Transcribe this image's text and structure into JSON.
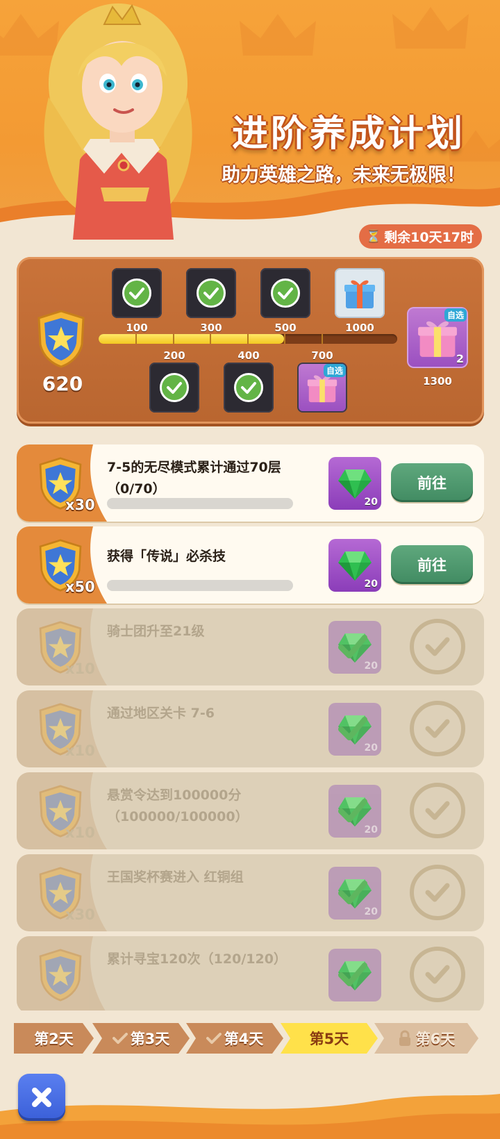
{
  "header": {
    "title": "进阶养成计划",
    "subtitle": "助力英雄之路，未来无极限！",
    "timer": "剩余10天17时"
  },
  "progress": {
    "current_points": "620",
    "current_value": 620,
    "max_value": 1000,
    "milestones_top": [
      {
        "label": "100",
        "reward": "check",
        "claimed": true
      },
      {
        "label": "300",
        "reward": "check",
        "claimed": true
      },
      {
        "label": "500",
        "reward": "check",
        "claimed": true
      },
      {
        "label": "1000",
        "reward": "gift-blue",
        "claimed": false
      }
    ],
    "milestones_bottom": [
      {
        "label": "200",
        "reward": "check",
        "claimed": true
      },
      {
        "label": "400",
        "reward": "check",
        "claimed": true
      },
      {
        "label": "700",
        "reward": "gift-pink",
        "tag": "自选",
        "claimed": false
      }
    ],
    "final_reward": {
      "label": "1300",
      "tag": "自选",
      "count": "2"
    }
  },
  "tasks": [
    {
      "desc": "7-5的无尽模式累计通过70层（0/70）",
      "multiplier": "x30",
      "gem_count": "20",
      "button": "前往",
      "progress": 0,
      "done": false
    },
    {
      "desc": "获得「传说」必杀技",
      "multiplier": "x50",
      "gem_count": "20",
      "button": "前往",
      "progress": 0,
      "done": false
    },
    {
      "desc": "骑士团升至21级",
      "multiplier": "x10",
      "gem_count": "20",
      "done": true
    },
    {
      "desc": "通过地区关卡 7-6",
      "multiplier": "x10",
      "gem_count": "20",
      "done": true
    },
    {
      "desc": "悬赏令达到100000分（100000/100000）",
      "multiplier": "x10",
      "gem_count": "20",
      "done": true
    },
    {
      "desc": "王国奖杯赛进入 红铜组",
      "multiplier": "x30",
      "gem_count": "20",
      "done": true
    },
    {
      "desc": "累计寻宝120次（120/120）",
      "multiplier": "",
      "gem_count": "",
      "done": true
    }
  ],
  "tabs": [
    {
      "label": "第2天",
      "state": "done"
    },
    {
      "label": "第3天",
      "state": "done"
    },
    {
      "label": "第4天",
      "state": "done"
    },
    {
      "label": "第5天",
      "state": "active"
    },
    {
      "label": "第6天",
      "state": "locked"
    }
  ],
  "colors": {
    "header_orange": "#f39a33",
    "panel_brown": "#c9733a",
    "go_green": "#4f9a70",
    "tab_active": "#ffe14a",
    "close_blue": "#4a6fe6"
  },
  "icons": {
    "close": "close-icon",
    "timer": "hourglass-icon",
    "lock": "lock-icon",
    "shield": "star-shield-icon",
    "gem": "green-gem-icon"
  }
}
